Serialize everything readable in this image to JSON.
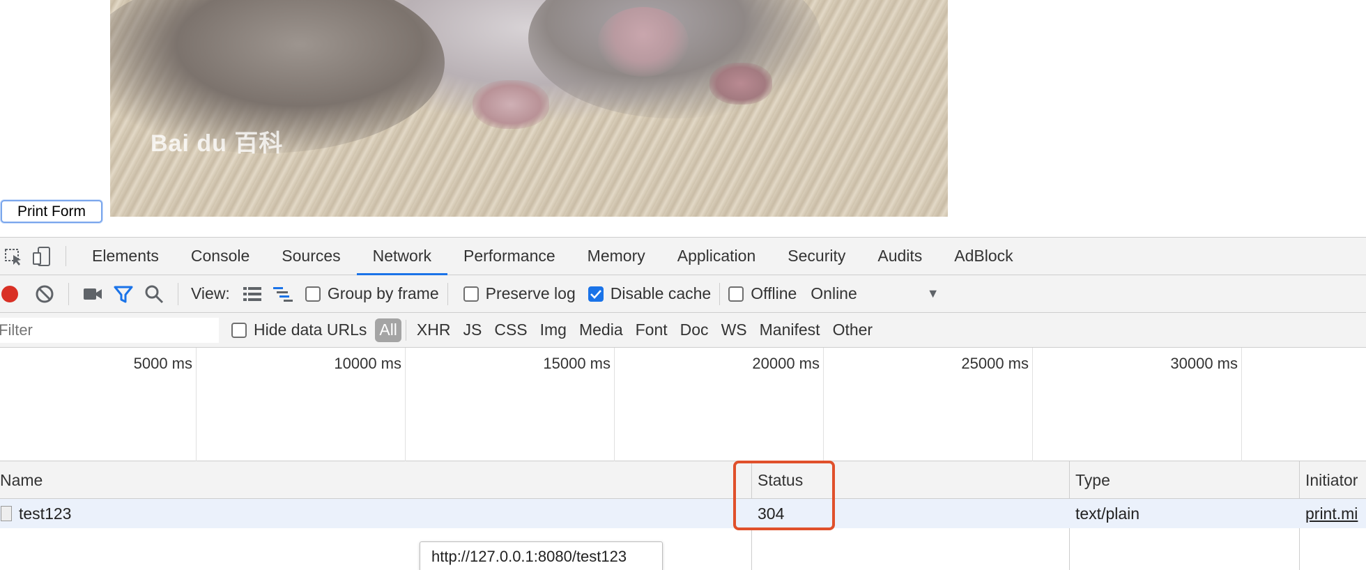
{
  "page": {
    "watermark": "Bai du 百科",
    "print_button": "Print Form"
  },
  "devtools": {
    "tabs": [
      "Elements",
      "Console",
      "Sources",
      "Network",
      "Performance",
      "Memory",
      "Application",
      "Security",
      "Audits",
      "AdBlock"
    ],
    "active_tab": "Network",
    "toolbar": {
      "view_label": "View:",
      "group_by_frame": {
        "label": "Group by frame",
        "checked": false
      },
      "preserve_log": {
        "label": "Preserve log",
        "checked": false
      },
      "disable_cache": {
        "label": "Disable cache",
        "checked": true
      },
      "offline": {
        "label": "Offline",
        "checked": false
      },
      "throttling": "Online"
    },
    "filter": {
      "placeholder": "Filter",
      "hide_data_urls": {
        "label": "Hide data URLs",
        "checked": false
      },
      "types": [
        "All",
        "XHR",
        "JS",
        "CSS",
        "Img",
        "Media",
        "Font",
        "Doc",
        "WS",
        "Manifest",
        "Other"
      ],
      "active_type": "All"
    },
    "overview_ticks": [
      "5000 ms",
      "10000 ms",
      "15000 ms",
      "20000 ms",
      "25000 ms",
      "30000 ms"
    ],
    "table": {
      "columns": [
        "Name",
        "Status",
        "Type",
        "Initiator"
      ],
      "rows": [
        {
          "name": "test123",
          "status": "304",
          "type": "text/plain",
          "initiator": "print.mi"
        }
      ]
    },
    "tooltip": "http://127.0.0.1:8080/test123"
  },
  "colors": {
    "accent": "#1a73e8",
    "highlight": "#e0502b",
    "record": "#d93025",
    "row_selected": "#ebf1fb"
  }
}
